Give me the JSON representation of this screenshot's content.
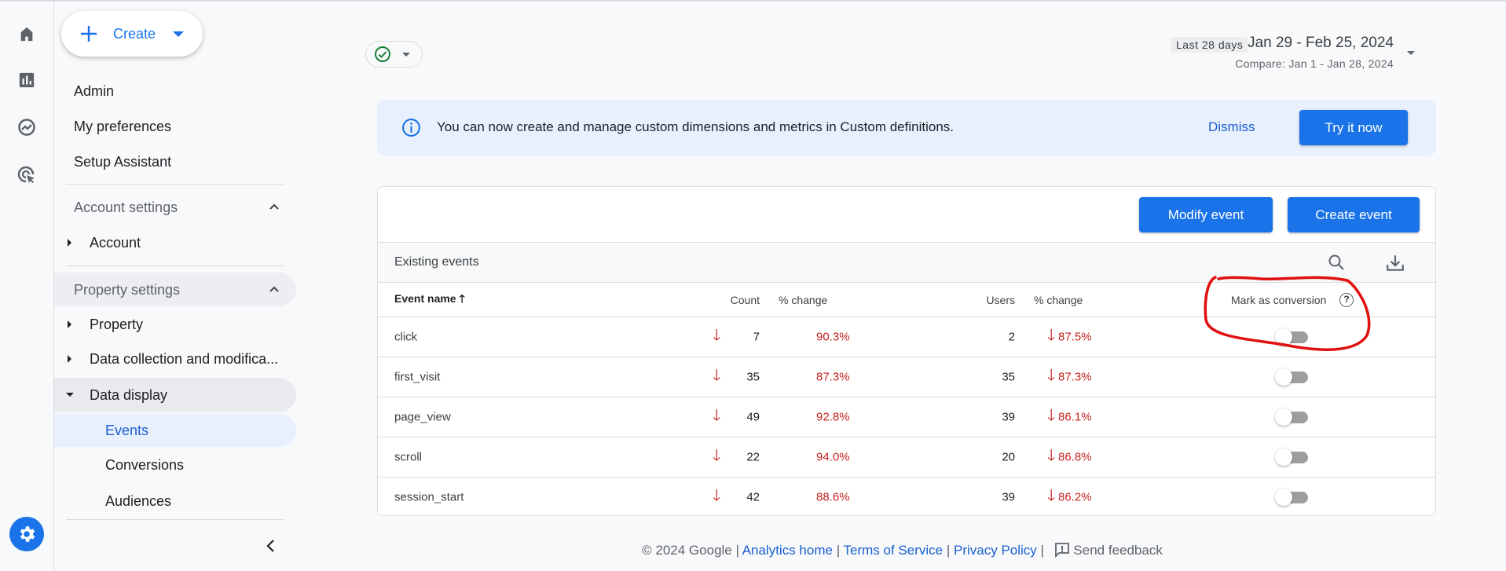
{
  "create_button": {
    "label": "Create"
  },
  "sidebar": {
    "top_items": [
      {
        "label": "Admin"
      },
      {
        "label": "My preferences"
      },
      {
        "label": "Setup Assistant"
      }
    ],
    "account_settings": {
      "label": "Account settings",
      "items": [
        {
          "label": "Account"
        }
      ]
    },
    "property_settings": {
      "label": "Property settings",
      "items": [
        {
          "label": "Property"
        },
        {
          "label": "Data collection and modifica..."
        },
        {
          "label": "Data display"
        }
      ]
    },
    "data_display_items": [
      {
        "label": "Events",
        "active": true
      },
      {
        "label": "Conversions"
      },
      {
        "label": "Audiences"
      }
    ]
  },
  "date_range": {
    "preset": "Last 28 days",
    "range": "Jan 29 - Feb 25, 2024",
    "compare": "Compare: Jan 1 - Jan 28, 2024"
  },
  "banner": {
    "text": "You can now create and manage custom dimensions and metrics in Custom definitions.",
    "dismiss": "Dismiss",
    "try": "Try it now"
  },
  "toolbar": {
    "modify": "Modify event",
    "create": "Create event"
  },
  "table": {
    "title": "Existing events",
    "headers": {
      "name": "Event name",
      "count": "Count",
      "count_change": "% change",
      "users": "Users",
      "users_change": "% change",
      "conversion": "Mark as conversion"
    },
    "rows": [
      {
        "name": "click",
        "count": "7",
        "count_change": "90.3%",
        "users": "2",
        "users_change": "87.5%",
        "conversion": false
      },
      {
        "name": "first_visit",
        "count": "35",
        "count_change": "87.3%",
        "users": "35",
        "users_change": "87.3%",
        "conversion": false
      },
      {
        "name": "page_view",
        "count": "49",
        "count_change": "92.8%",
        "users": "39",
        "users_change": "86.1%",
        "conversion": false
      },
      {
        "name": "scroll",
        "count": "22",
        "count_change": "94.0%",
        "users": "20",
        "users_change": "86.8%",
        "conversion": false
      },
      {
        "name": "session_start",
        "count": "42",
        "count_change": "88.6%",
        "users": "39",
        "users_change": "86.2%",
        "conversion": false
      }
    ]
  },
  "footer": {
    "copyright": "© 2024 Google",
    "analytics_home": "Analytics home",
    "terms": "Terms of Service",
    "privacy": "Privacy Policy",
    "feedback": "Send feedback"
  },
  "colors": {
    "accent": "#1a73e8",
    "negative": "#c5221f",
    "annotation": "#e01010"
  }
}
